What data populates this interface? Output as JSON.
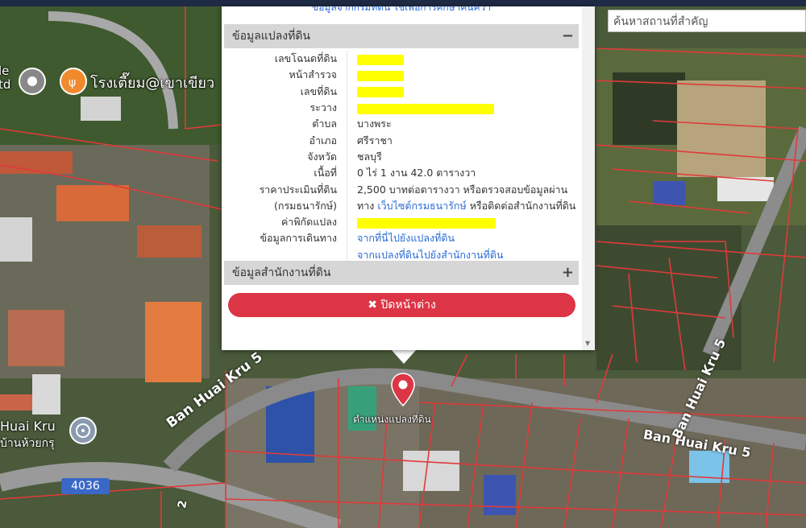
{
  "colors": {
    "parcel_line": "#e03a3a",
    "accent_red": "#dc3545",
    "link": "#2a6bd6",
    "highlight": "#ffff00",
    "route_badge": "#3a68c7"
  },
  "search": {
    "placeholder": "ค้นหาสถานที่สำคัญ"
  },
  "popup": {
    "top_text": "ข้อมูลจากกรมที่ดิน ใช้เพื่อการศึกษาค้นคว้า",
    "land_section": {
      "title": "ข้อมูลแปลงที่ดิน",
      "toggle": "−",
      "rows": [
        {
          "label": "เลขโฉนดที่ดิน",
          "value": "",
          "redacted": true
        },
        {
          "label": "หน้าสำรวจ",
          "value": "",
          "redacted": true
        },
        {
          "label": "เลขที่ดิน",
          "value": "",
          "redacted": true
        },
        {
          "label": "ระวาง",
          "value": "",
          "redacted": true
        },
        {
          "label": "ตำบล",
          "value": "บางพระ"
        },
        {
          "label": "อำเภอ",
          "value": "ศรีราชา"
        },
        {
          "label": "จังหวัด",
          "value": "ชลบุรี"
        },
        {
          "label": "เนื้อที่",
          "value": "0 ไร่ 1 งาน 42.0 ตารางวา"
        },
        {
          "label": "ราคาประเมินที่ดิน",
          "value": "2,500 บาทต่อตารางวา หรือตรวจสอบข้อมูลผ่าน"
        },
        {
          "label": "(กรมธนารักษ์)",
          "value_prefix": "ทาง",
          "link": "เว็บไซต์กรมธนารักษ์",
          "value_suffix": "หรือติดต่อสำนักงานที่ดิน"
        },
        {
          "label": "ค่าพิกัดแปลง",
          "value": "",
          "redacted": true
        },
        {
          "label": "ข้อมูลการเดินทาง",
          "link": "จากที่นี่ไปยังแปลงที่ดิน"
        },
        {
          "label": "",
          "link": "จากแปลงที่ดินไปยังสำนักงานที่ดิน"
        }
      ]
    },
    "office_section": {
      "title": "ข้อมูลสำนักงานที่ดิน",
      "toggle": "+"
    },
    "close_button": {
      "icon": "✖",
      "label": "ปิดหน้าต่าง"
    }
  },
  "map": {
    "labels": {
      "poi_restaurant": "โรงเตี๊ยม@เขาเขียว",
      "poi_partial": "le\ntd",
      "place_huai_kru_en": "Huai Kru",
      "place_huai_kru_th": "บ้านห้วยกรุ",
      "road_1": "Ban Huai Kru 5",
      "road_2": "Ban Huai Kru 5",
      "route": "4036",
      "marker_label": "ตำแหน่งแปลงที่ดิน",
      "edge_2": "2"
    },
    "icons": [
      "map-pin-icon",
      "restaurant-icon",
      "temple-icon",
      "location-marker-icon"
    ]
  }
}
